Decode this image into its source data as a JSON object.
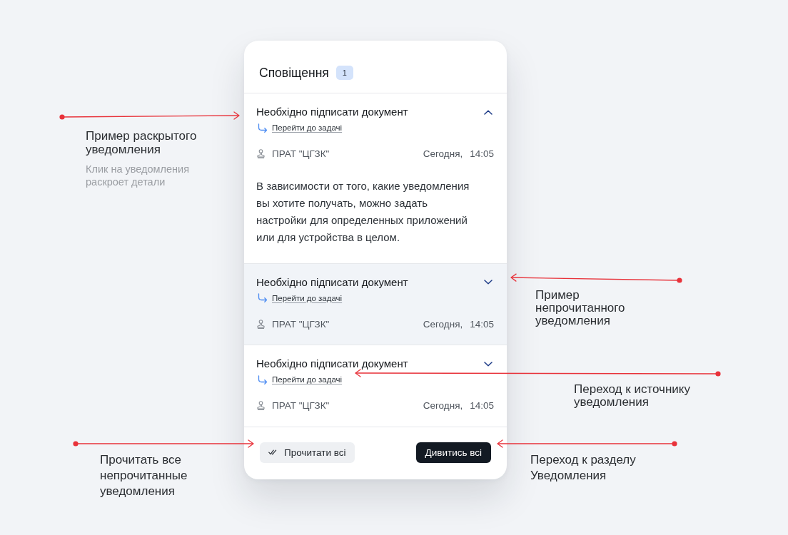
{
  "panel": {
    "title": "Сповіщення",
    "badge": "1"
  },
  "notifications": [
    {
      "title": "Необхідно підписати документ",
      "expanded": true,
      "unread": false,
      "link": "Перейти до задачі",
      "sender": "ПРАТ \"ЦГЗК\"",
      "date": "Сегодня,",
      "time": "14:05",
      "body": "В зависимости от того, какие уведомления\nвы хотите получать, можно задать\nнастройки для определенных приложений\nили для устройства в целом."
    },
    {
      "title": "Необхідно підписати документ",
      "expanded": false,
      "unread": true,
      "link": "Перейти до задачі",
      "sender": "ПРАТ \"ЦГЗК\"",
      "date": "Сегодня,",
      "time": "14:05"
    },
    {
      "title": "Необхідно підписати документ",
      "expanded": false,
      "unread": false,
      "link": "Перейти до задачі",
      "sender": "ПРАТ \"ЦГЗК\"",
      "date": "Сегодня,",
      "time": "14:05"
    }
  ],
  "footer": {
    "buttons": [
      {
        "label": "Прочитати всі",
        "kind": "secondary"
      },
      {
        "label": "Дивитись всі",
        "kind": "primary"
      }
    ]
  },
  "annotations": [
    {
      "title": "Пример раскрытого уведомления",
      "note": "Клик на уведомления раскроет детали"
    },
    {
      "title": "Пример непрочитанного уведомления"
    },
    {
      "title": "Переход к источнику уведомления"
    },
    {
      "title": "Прочитать все непрочитанные уведомления"
    },
    {
      "title": "Переход к разделу Уведомления"
    }
  ]
}
